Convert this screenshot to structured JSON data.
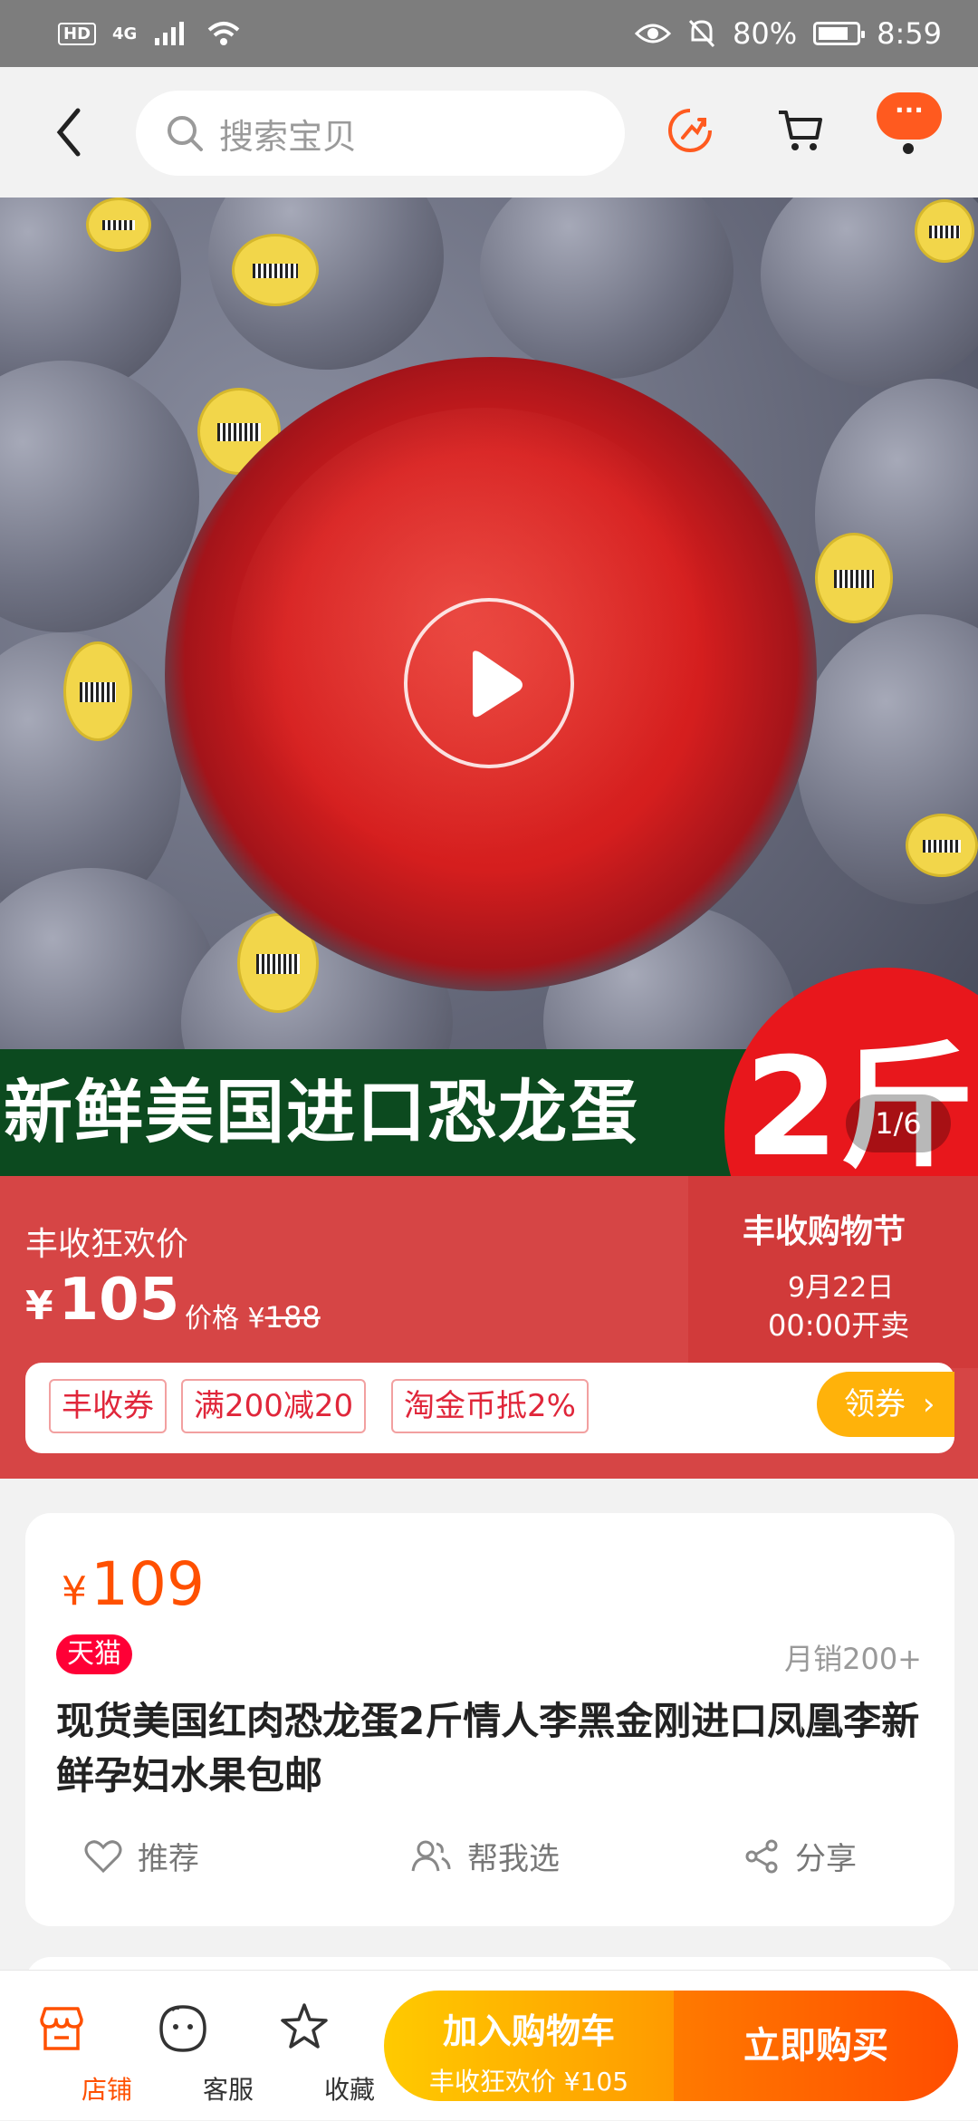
{
  "status_bar": {
    "hd": "HD",
    "network": "4G",
    "battery_percent": "80%",
    "battery_level": 0.8,
    "time": "8:59"
  },
  "top_nav": {
    "search_placeholder": "搜索宝贝",
    "more_label": "···"
  },
  "hero": {
    "banner_text": "新鲜美国进口恐龙蛋",
    "weight_badge": "2斤",
    "page_indicator": "1/6"
  },
  "promo": {
    "label": "丰收狂欢价",
    "currency": "¥",
    "price": "105",
    "orig_prefix": "价格 ¥",
    "orig_price": "188",
    "festival_title": "丰收购物节",
    "festival_date": "9月22日",
    "festival_time": "00:00开卖",
    "coupons": [
      "丰收券",
      "满200减20",
      "淘金币抵2%"
    ],
    "claim_label": "领券",
    "claim_arrow": "›"
  },
  "product": {
    "currency": "¥",
    "price": "109",
    "badge": "天猫",
    "monthly_sales": "月销200+",
    "title": "现货美国红肉恐龙蛋2斤情人李黑金刚进口凤凰李新鲜孕妇水果包邮",
    "actions": [
      "推荐",
      "帮我选",
      "分享"
    ]
  },
  "bottom_bar": {
    "tabs": [
      "店铺",
      "客服",
      "收藏"
    ],
    "cart_label": "加入购物车",
    "cart_sub": "丰收狂欢价 ¥105",
    "buy_label": "立即购买"
  },
  "colors": {
    "accent": "#ff5000",
    "promo_bg": "#d64545",
    "tmall": "#ff0036"
  }
}
